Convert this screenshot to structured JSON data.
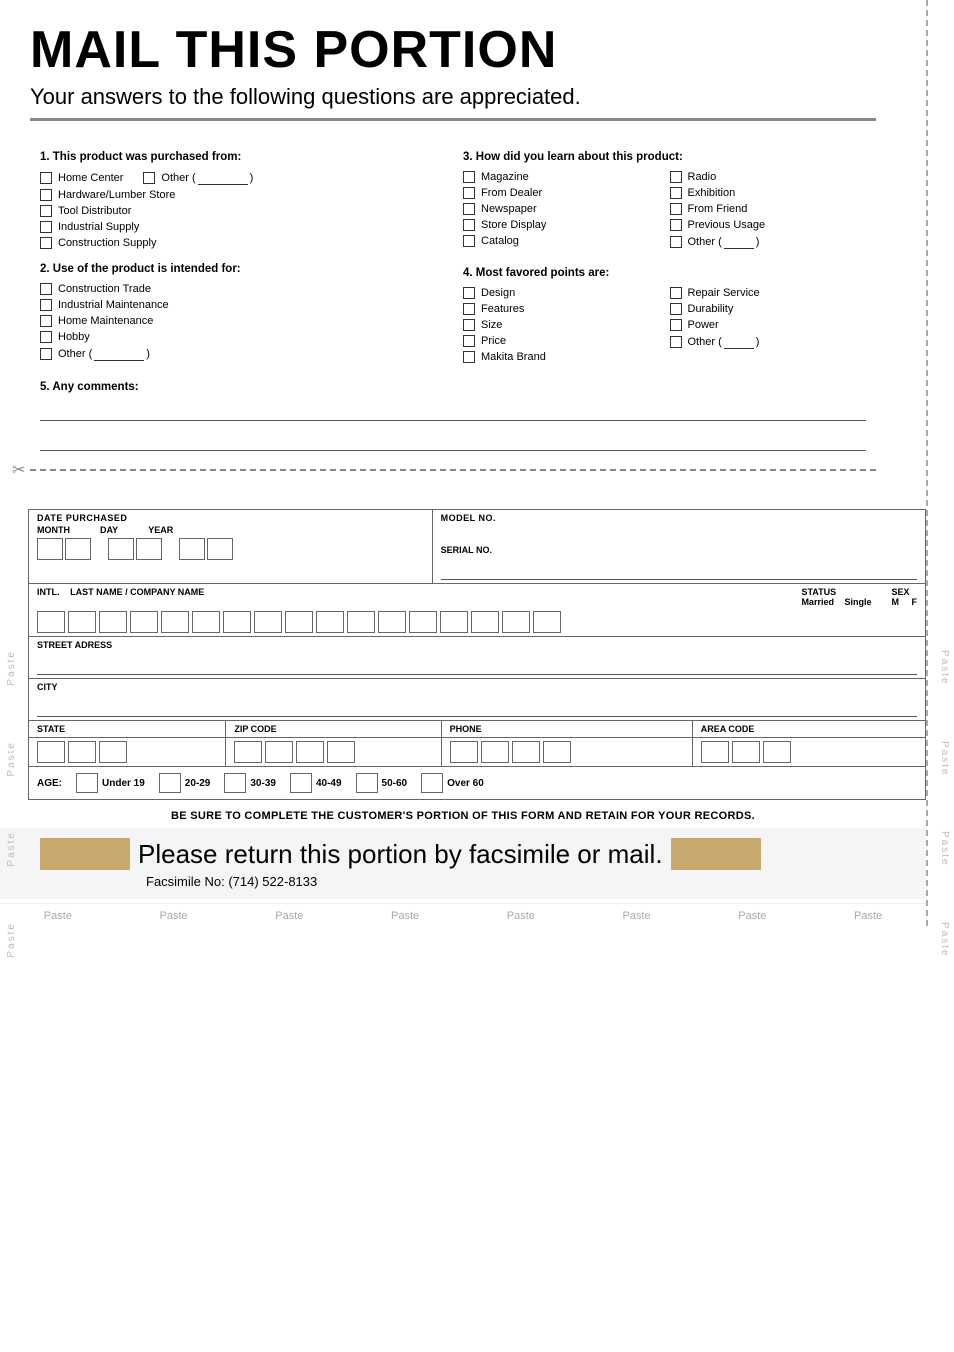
{
  "page": {
    "title": "MAIL THIS PORTION",
    "subtitle": "Your answers to the following questions are appreciated."
  },
  "sections": {
    "q1": {
      "label": "1. This product was purchased from:",
      "options": [
        "Home Center",
        "Hardware/Lumber Store",
        "Tool Distributor",
        "Industrial Supply",
        "Construction Supply"
      ],
      "other_label": "Other (",
      "other_close": ")"
    },
    "q2": {
      "label": "2. Use of the product is intended for:",
      "options": [
        "Construction Trade",
        "Industrial Maintenance",
        "Home Maintenance",
        "Hobby"
      ],
      "other_label": "Other (",
      "other_close": ")"
    },
    "q3": {
      "label": "3. How did you learn about this product:",
      "col1": [
        "Magazine",
        "From Dealer",
        "Newspaper",
        "Store Display",
        "Catalog"
      ],
      "col2": [
        "Radio",
        "Exhibition",
        "From Friend",
        "Previous Usage"
      ],
      "other_label": "Other (",
      "other_close": ")"
    },
    "q4": {
      "label": "4. Most favored points are:",
      "col1": [
        "Design",
        "Features",
        "Size",
        "Price",
        "Makita Brand"
      ],
      "col2": [
        "Repair Service",
        "Durability",
        "Power"
      ],
      "other_label": "Other (",
      "other_close": ")"
    },
    "q5": {
      "label": "5. Any comments:"
    }
  },
  "form": {
    "date_purchased": "DATE PURCHASED",
    "month": "MONTH",
    "day": "DAY",
    "year": "YEAR",
    "model_no": "MODEL NO.",
    "serial_no": "SERIAL NO.",
    "intl": "INTL.",
    "last_name_company": "LAST NAME / COMPANY NAME",
    "status": "STATUS",
    "married": "Married",
    "single": "Single",
    "sex": "SEX",
    "m": "M",
    "f": "F",
    "street": "STREET ADRESS",
    "city": "CITY",
    "state": "STATE",
    "zip_code": "ZIP CODE",
    "phone": "PHONE",
    "area_code": "AREA CODE",
    "age_label": "AGE:",
    "age_ranges": [
      "Under 19",
      "20-29",
      "30-39",
      "40-49",
      "50-60",
      "Over 60"
    ]
  },
  "bottom": {
    "notice": "BE SURE TO COMPLETE THE CUSTOMER'S PORTION OF THIS FORM AND RETAIN FOR YOUR RECORDS.",
    "return_line": "Please return this portion by facsimile or mail.",
    "facsimile": "Facsimile No: (714) 522-8133"
  },
  "paste_labels": [
    "Paste",
    "Paste",
    "Paste",
    "Paste",
    "Paste",
    "Paste",
    "Paste",
    "Paste"
  ],
  "paste_side_left": [
    "Paste",
    "Paste",
    "Paste",
    "Paste"
  ],
  "paste_side_right": [
    "Paste",
    "Paste",
    "Paste",
    "Paste"
  ]
}
